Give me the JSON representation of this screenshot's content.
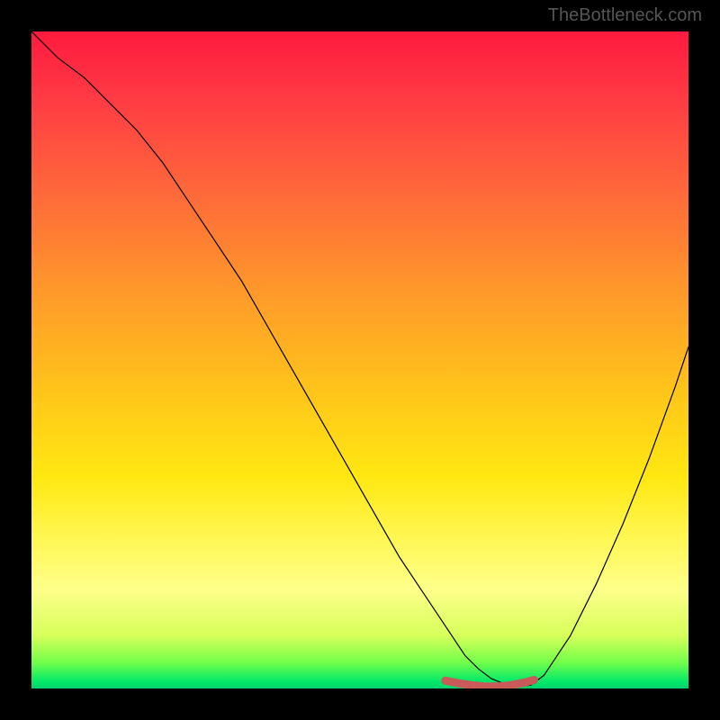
{
  "watermark": "TheBottleneck.com",
  "chart_data": {
    "type": "line",
    "title": "",
    "xlabel": "",
    "ylabel": "",
    "xlim": [
      0,
      100
    ],
    "ylim": [
      0,
      100
    ],
    "series": [
      {
        "name": "bottleneck-curve",
        "color": "#000000",
        "x": [
          0,
          4,
          8,
          12,
          16,
          20,
          24,
          28,
          32,
          36,
          40,
          44,
          48,
          52,
          56,
          60,
          62,
          64,
          66,
          68,
          70,
          72,
          74,
          76,
          78,
          82,
          86,
          90,
          94,
          98,
          100
        ],
        "y": [
          100,
          96,
          93,
          89,
          85,
          80,
          74,
          68,
          62,
          55,
          48,
          41,
          34,
          27,
          20,
          14,
          11,
          8,
          5,
          3,
          1.5,
          0.7,
          0.3,
          0.5,
          2,
          8,
          16,
          25,
          35,
          46,
          52
        ]
      },
      {
        "name": "highlight-segment",
        "color": "#c85a5a",
        "x": [
          63,
          65,
          67,
          69,
          71,
          73,
          75,
          76.5
        ],
        "y": [
          1.2,
          0.8,
          0.5,
          0.3,
          0.3,
          0.5,
          0.9,
          1.3
        ]
      }
    ],
    "gradient_stops": [
      {
        "pct": 0,
        "color": "#ff1a3e"
      },
      {
        "pct": 10,
        "color": "#ff3a44"
      },
      {
        "pct": 25,
        "color": "#ff6a3a"
      },
      {
        "pct": 40,
        "color": "#ff9a2a"
      },
      {
        "pct": 55,
        "color": "#ffc51a"
      },
      {
        "pct": 68,
        "color": "#ffe812"
      },
      {
        "pct": 78,
        "color": "#fff85a"
      },
      {
        "pct": 85,
        "color": "#fdff8a"
      },
      {
        "pct": 92,
        "color": "#d6ff5a"
      },
      {
        "pct": 96,
        "color": "#74ff4a"
      },
      {
        "pct": 99,
        "color": "#00e86a"
      },
      {
        "pct": 100,
        "color": "#00d26a"
      }
    ]
  }
}
